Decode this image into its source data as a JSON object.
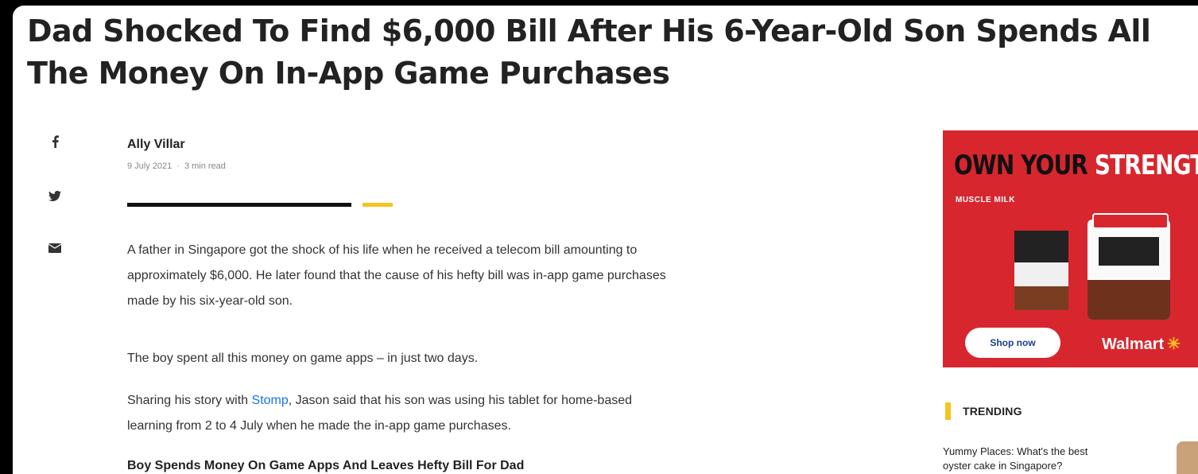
{
  "article": {
    "headline": "Dad Shocked To Find $6,000 Bill After His 6-Year-Old Son Spends All The Money On In-App Game Purchases",
    "author": "Ally Villar",
    "date": "9 July 2021",
    "meta_separator": "·",
    "read_time": "3 min read",
    "paragraphs": [
      "A father in Singapore got the shock of his life when he received a telecom bill amounting to approximately $6,000. He later found that the cause of his hefty bill was in-app game purchases made by his six-year-old son.",
      "The boy spent all this money on game apps – in just two days."
    ],
    "p3": {
      "before_link": "Sharing his story with ",
      "link_text": "Stomp",
      "after_link": ", Jason said that his son was using his tablet for home-based learning from 2 to 4 July when he made the in-app game purchases."
    },
    "subhead": "Boy Spends Money On Game Apps And Leaves Hefty Bill For Dad"
  },
  "share": {
    "icons": [
      "facebook-icon",
      "twitter-icon",
      "email-icon"
    ]
  },
  "ad": {
    "headline_dark": "OWN YOUR ",
    "headline_light": "STRENGTH",
    "brand": "MUSCLE MILK",
    "cta": "Shop now",
    "retailer": "Walmart",
    "retailer_mark": "✳",
    "colors": {
      "background": "#d8262f",
      "accent": "#f4c51f"
    }
  },
  "trending": {
    "label": "TRENDING",
    "items": [
      {
        "title": "Yummy Places: What's the best oyster cake in Singapore?"
      }
    ]
  }
}
